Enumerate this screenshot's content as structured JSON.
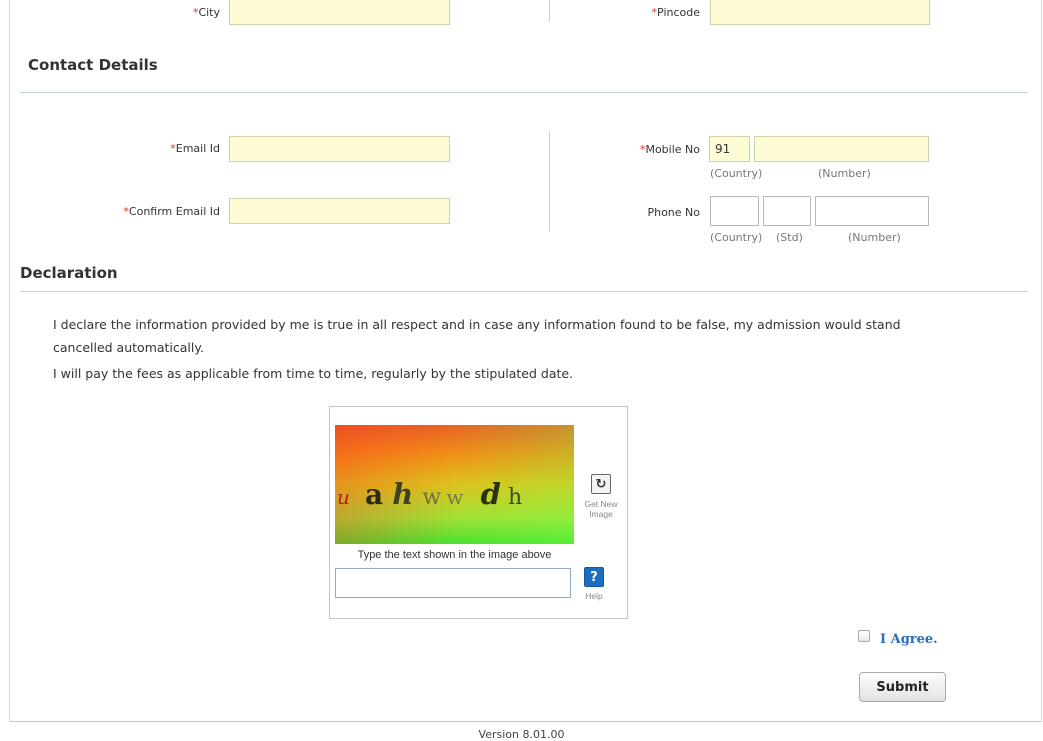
{
  "address": {
    "city_label": "City",
    "pincode_label": "Pincode",
    "required_mark": "*"
  },
  "contact": {
    "section_title": "Contact Details",
    "email_label": "Email Id",
    "confirm_email_label": "Confirm Email Id",
    "mobile_label": "Mobile No",
    "mobile_country_value": "91",
    "mobile_country_hint": "(Country)",
    "mobile_number_hint": "(Number)",
    "phone_label": "Phone No",
    "phone_country_hint": "(Country)",
    "phone_std_hint": "(Std)",
    "phone_number_hint": "(Number)"
  },
  "declaration": {
    "section_title": "Declaration",
    "line1": "I declare the information provided by me is true in all respect and in case any information found to be false, my admission would stand",
    "line2": "cancelled automatically.",
    "line3": "I will pay the fees as applicable from time to time, regularly by the stipulated date."
  },
  "captcha": {
    "image_chars": [
      "u",
      "a",
      "h",
      "w",
      "w",
      "d",
      "h"
    ],
    "instruction": "Type the text shown in the image above",
    "refresh_icon": "refresh-icon",
    "refresh_label_1": "Get New",
    "refresh_label_2": "Image",
    "help_icon": "help-icon",
    "help_glyph": "?",
    "help_label": "Help"
  },
  "agree": {
    "label": "I Agree."
  },
  "submit": {
    "label": "Submit"
  },
  "footer": {
    "version": "Version 8.01.00"
  },
  "colors": {
    "field_bg": "#fdfbd3",
    "required": "#e03030",
    "link": "#2a6cc0",
    "help_bg": "#1a6fc4"
  }
}
